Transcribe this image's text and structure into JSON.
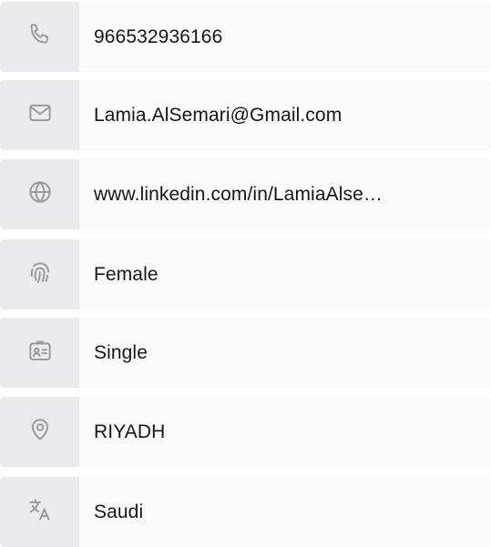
{
  "contact": {
    "phone": {
      "icon": "phone-icon",
      "value": "966532936166"
    },
    "email": {
      "icon": "mail-icon",
      "value": "Lamia.AlSemari@Gmail.com"
    },
    "website": {
      "icon": "globe-icon",
      "value": "www.linkedin.com/in/LamiaAlse…"
    },
    "gender": {
      "icon": "fingerprint-icon",
      "value": "Female"
    },
    "marital_status": {
      "icon": "id-card-icon",
      "value": "Single"
    },
    "location": {
      "icon": "map-pin-icon",
      "value": "RIYADH"
    },
    "nationality": {
      "icon": "translate-icon",
      "value": "Saudi"
    }
  },
  "colors": {
    "icon_bg": "#ebebed",
    "row_bg": "#fafafb",
    "icon_stroke": "#9a9aa3",
    "text": "#16161a"
  }
}
